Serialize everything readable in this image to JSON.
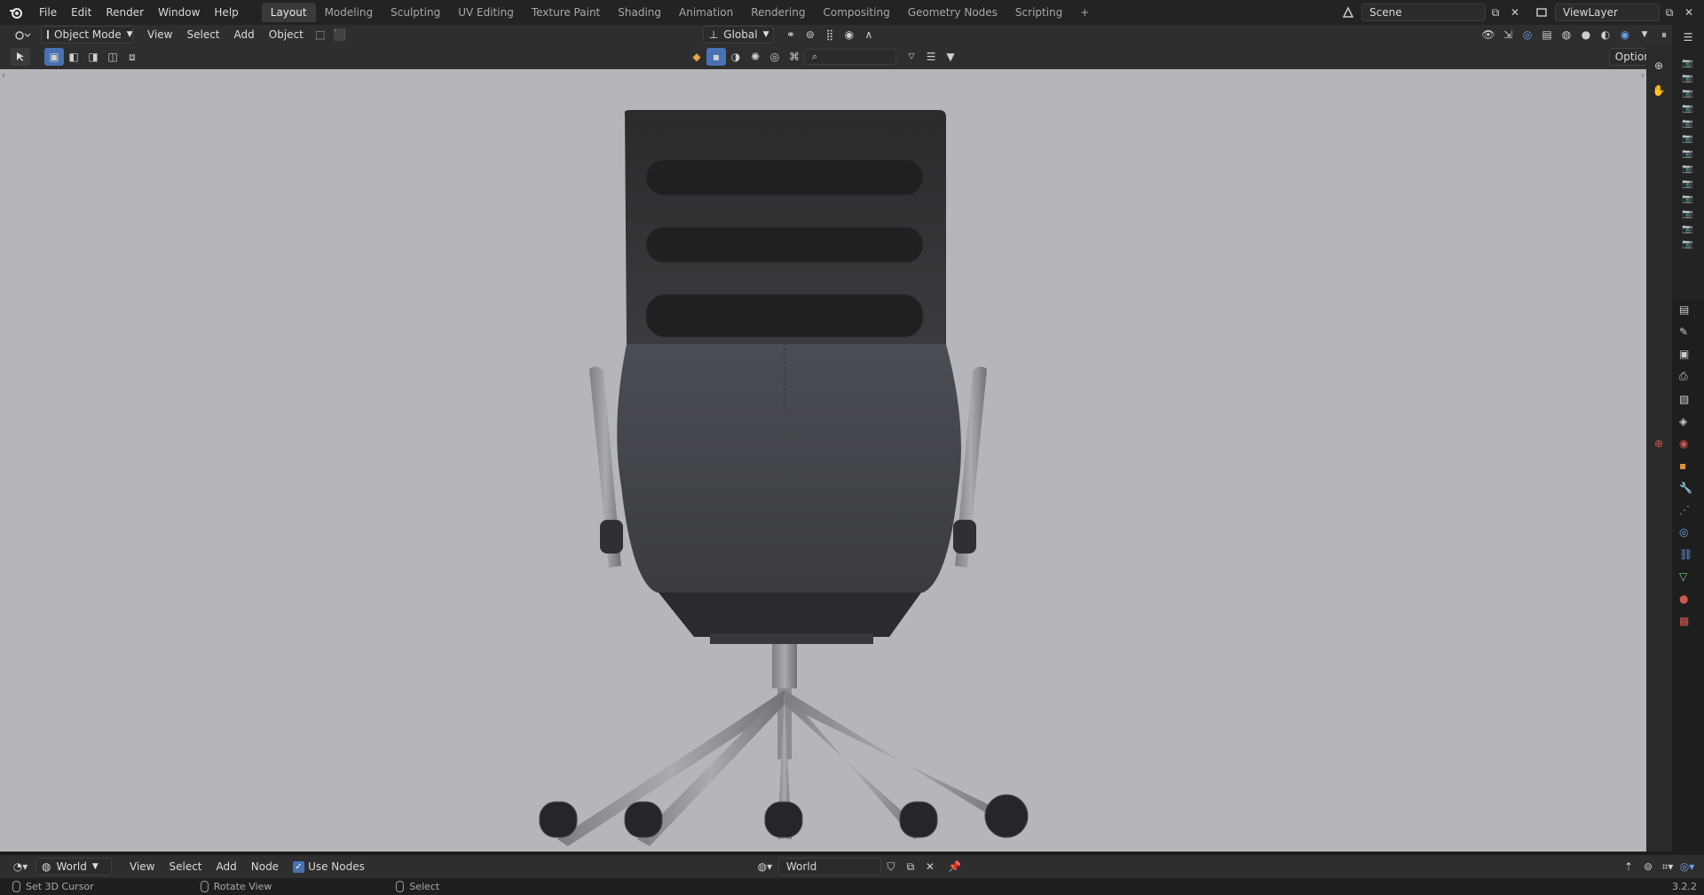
{
  "topbar": {
    "menus": [
      "File",
      "Edit",
      "Render",
      "Window",
      "Help"
    ],
    "workspaces": [
      "Layout",
      "Modeling",
      "Sculpting",
      "UV Editing",
      "Texture Paint",
      "Shading",
      "Animation",
      "Rendering",
      "Compositing",
      "Geometry Nodes",
      "Scripting"
    ],
    "active_workspace": "Layout",
    "add_tab": "+",
    "scene": "Scene",
    "view_layer": "ViewLayer"
  },
  "viewport_header": {
    "mode": "Object Mode",
    "menus": [
      "View",
      "Select",
      "Add",
      "Object"
    ],
    "orientation": "Global",
    "options": "Options"
  },
  "node_header": {
    "world_selector": "World",
    "menus": [
      "View",
      "Select",
      "Add",
      "Node"
    ],
    "use_nodes": "Use Nodes",
    "world_name": "World"
  },
  "statusbar": {
    "items": [
      "Set 3D Cursor",
      "Rotate View",
      "Select"
    ],
    "version": "3.2.2"
  },
  "colors": {
    "accent": "#4772b3",
    "viewport_bg": "#b5b6ba",
    "panel": "#2e2e2e"
  },
  "icons": [
    "blender-logo-icon",
    "editor-type-icon",
    "scene-icon",
    "view-layer-icon",
    "camera-icon",
    "hand-icon",
    "zoom-icon",
    "cursor-icon",
    "world-icon",
    "pin-icon"
  ]
}
